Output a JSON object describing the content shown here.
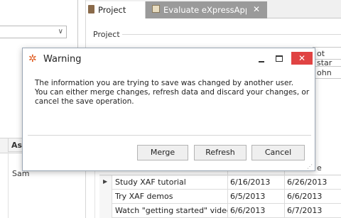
{
  "left": {
    "combo_arrow": "∨",
    "grid_header": "As",
    "cell_value": "Sam"
  },
  "tabs": [
    {
      "label": "Project",
      "icon": "project-icon"
    },
    {
      "label": "Evaluate eXpressApp Fr",
      "icon": "task-icon",
      "close": "✕"
    }
  ],
  "project": {
    "group_label": "Project",
    "peek_field_1": "ot star",
    "peek_field_2": "ohn"
  },
  "grid": {
    "header_peek": "e",
    "row_pointer": "▶",
    "rows": [
      {
        "subject": "Study XAF tutorial",
        "start": "6/16/2013",
        "due": "6/26/2013"
      },
      {
        "subject": "Try XAF demos",
        "start": "6/5/2013",
        "due": "6/6/2013"
      },
      {
        "subject": "Watch \"getting started\" videos",
        "start": "6/6/2013",
        "due": "6/7/2013"
      }
    ]
  },
  "dialog": {
    "title": "Warning",
    "icon": "warning-gear-icon",
    "close_glyph": "✕",
    "message_lines": [
      "The information you are trying to save was changed by another user.",
      "You can either merge changes, refresh data and discard your changes, or",
      "cancel the save operation."
    ],
    "buttons": {
      "merge": "Merge",
      "refresh": "Refresh",
      "cancel": "Cancel"
    },
    "accent_color": "#e05a1e",
    "close_color": "#e04343"
  }
}
